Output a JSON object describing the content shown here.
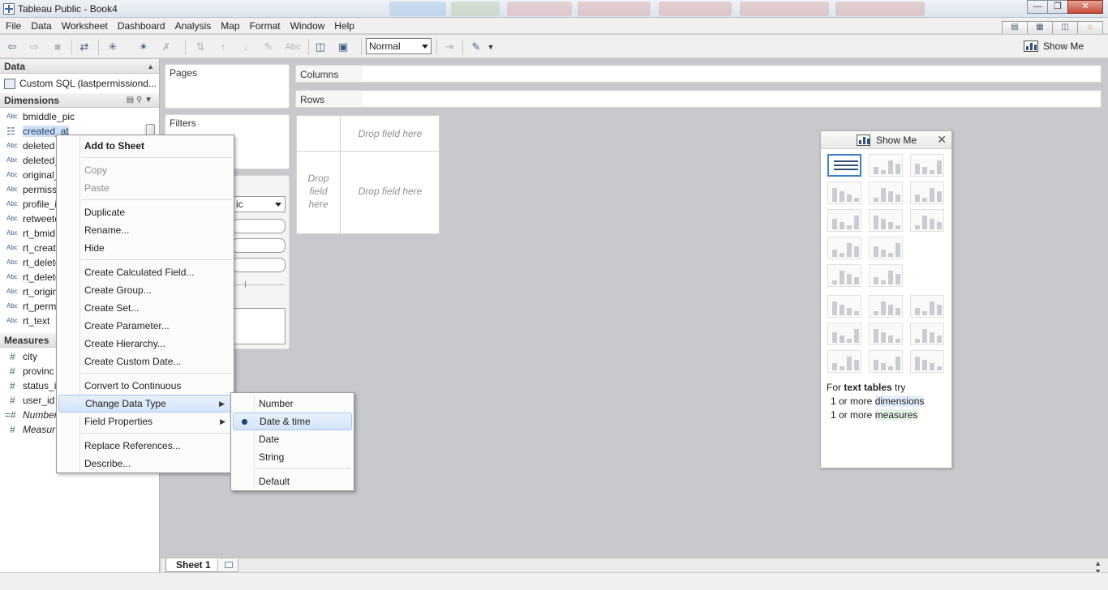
{
  "window": {
    "title": "Tableau Public - Book4"
  },
  "menu": [
    "File",
    "Data",
    "Worksheet",
    "Dashboard",
    "Analysis",
    "Map",
    "Format",
    "Window",
    "Help"
  ],
  "toolbar": {
    "fit_select": "Normal",
    "show_me_label": "Show Me",
    "abc_label": "Abc"
  },
  "data_pane": {
    "header": "Data",
    "datasource": "Custom SQL (lastpermissiond...",
    "dimensions_header": "Dimensions",
    "dimensions": [
      {
        "type": "Abc",
        "name": "bmiddle_pic"
      },
      {
        "type": "cal",
        "name": "created_at"
      },
      {
        "type": "Abc",
        "name": "deleted"
      },
      {
        "type": "Abc",
        "name": "deleted_"
      },
      {
        "type": "Abc",
        "name": "original_"
      },
      {
        "type": "Abc",
        "name": "permiss"
      },
      {
        "type": "Abc",
        "name": "profile_i"
      },
      {
        "type": "Abc",
        "name": "retweete"
      },
      {
        "type": "Abc",
        "name": "rt_bmid"
      },
      {
        "type": "Abc",
        "name": "rt_create"
      },
      {
        "type": "Abc",
        "name": "rt_delete"
      },
      {
        "type": "Abc",
        "name": "rt_delete"
      },
      {
        "type": "Abc",
        "name": "rt_origin"
      },
      {
        "type": "Abc",
        "name": "rt_perm"
      },
      {
        "type": "Abc",
        "name": "rt_text"
      }
    ],
    "measures_header": "Measures",
    "measures": [
      {
        "type": "#",
        "name": "city"
      },
      {
        "type": "#",
        "name": "provinc"
      },
      {
        "type": "#",
        "name": "status_i"
      },
      {
        "type": "#",
        "name": "user_id"
      },
      {
        "type": "=#",
        "name": "Number"
      },
      {
        "type": "#",
        "name": "Measur"
      }
    ]
  },
  "shelves": {
    "pages": "Pages",
    "filters": "Filters",
    "columns": "Columns",
    "rows": "Rows",
    "marks_type": "ic"
  },
  "canvas": {
    "drop_top": "Drop field here",
    "drop_main": "Drop field here",
    "drop_left": "Drop\nfield\nhere"
  },
  "context_menu": {
    "items": [
      {
        "label": "Add to Sheet",
        "style": "bold"
      },
      {
        "label": "Copy",
        "style": "disabled"
      },
      {
        "label": "Paste",
        "style": "disabled"
      },
      {
        "label": "Duplicate",
        "style": ""
      },
      {
        "label": "Rename...",
        "style": ""
      },
      {
        "label": "Hide",
        "style": ""
      },
      {
        "label": "Create Calculated Field...",
        "style": ""
      },
      {
        "label": "Create Group...",
        "style": ""
      },
      {
        "label": "Create Set...",
        "style": ""
      },
      {
        "label": "Create Parameter...",
        "style": ""
      },
      {
        "label": "Create Hierarchy...",
        "style": ""
      },
      {
        "label": "Create Custom Date...",
        "style": ""
      },
      {
        "label": "Convert to Continuous",
        "style": ""
      },
      {
        "label": "Change Data Type",
        "style": "hover"
      },
      {
        "label": "Field Properties",
        "style": ""
      },
      {
        "label": "Replace References...",
        "style": ""
      },
      {
        "label": "Describe...",
        "style": ""
      }
    ]
  },
  "data_type_submenu": {
    "items": [
      "Number",
      "Date & time",
      "Date",
      "String",
      "Default"
    ],
    "selected": "Date & time"
  },
  "show_me": {
    "title": "Show Me",
    "hint_prefix": "For ",
    "hint_bold": "text tables",
    "hint_suffix": " try",
    "req1_count": "1 or more ",
    "req1_kind": "dimensions",
    "req2_count": "1 or more ",
    "req2_kind": "measures"
  },
  "sheets": {
    "active": "Sheet 1"
  }
}
